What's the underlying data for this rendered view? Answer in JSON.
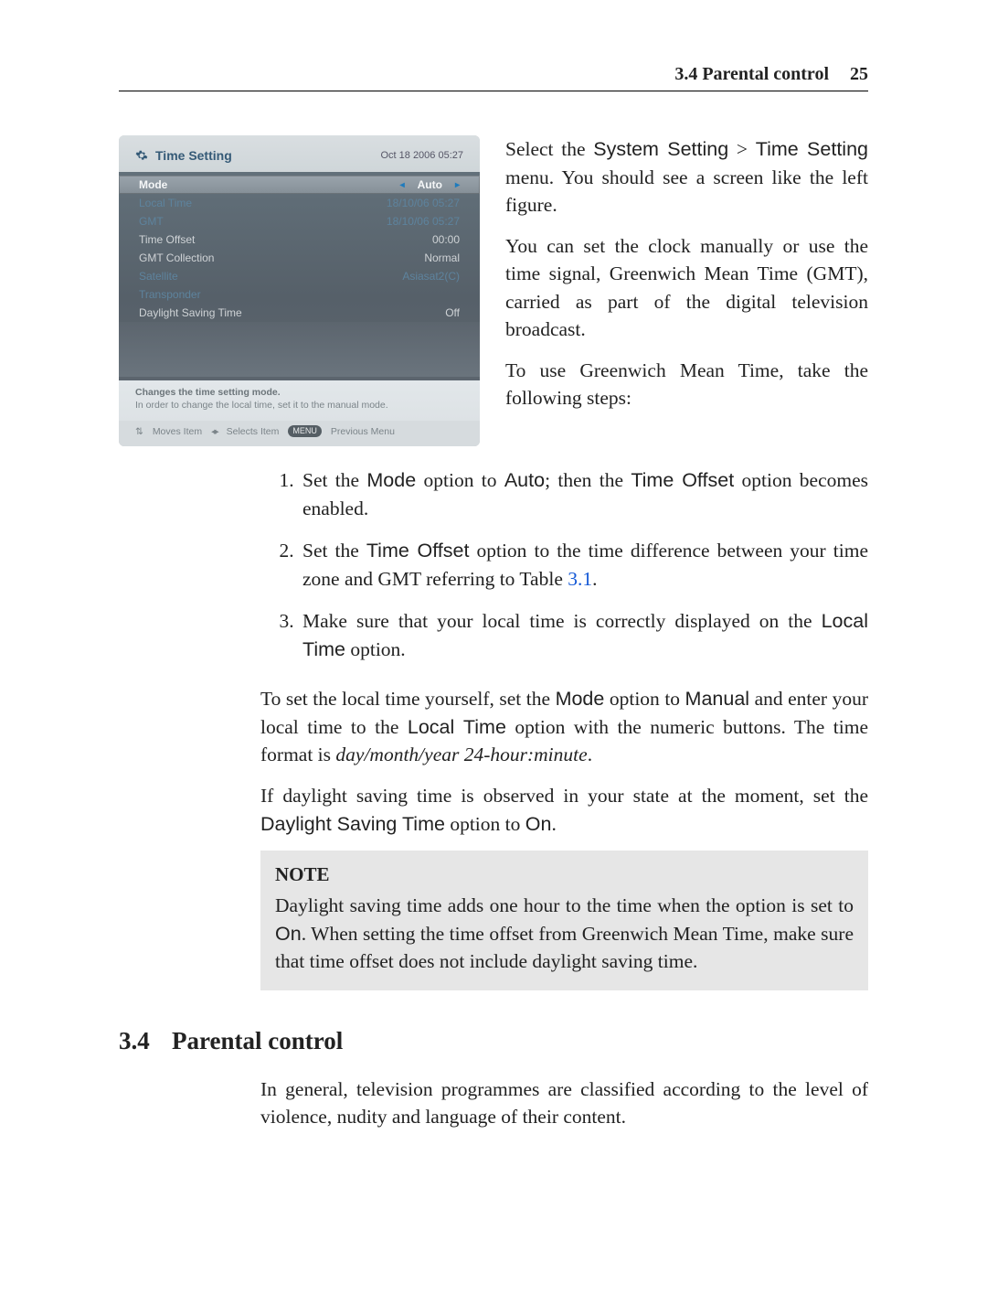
{
  "header": {
    "section": "3.4 Parental control",
    "page": "25"
  },
  "screenshot": {
    "title": "Time Setting",
    "timestamp": "Oct 18 2006 05:27",
    "rows": [
      {
        "label": "Mode",
        "value": "Auto",
        "state": "selected",
        "arrows": true
      },
      {
        "label": "Local Time",
        "value": "18/10/06 05:27",
        "state": "dim"
      },
      {
        "label": "GMT",
        "value": "18/10/06 05:27",
        "state": "dim"
      },
      {
        "label": "Time Offset",
        "value": "00:00",
        "state": "normal"
      },
      {
        "label": "GMT Collection",
        "value": "Normal",
        "state": "normal"
      },
      {
        "label": "Satellite",
        "value": "Asiasat2(C)",
        "state": "dim"
      },
      {
        "label": "Transponder",
        "value": "",
        "state": "dim"
      },
      {
        "label": "Daylight Saving Time",
        "value": "Off",
        "state": "normal"
      }
    ],
    "help1": "Changes the time setting mode.",
    "help2": "In order to change the local time, set it to the manual mode.",
    "foot_moves": "Moves Item",
    "foot_selects": "Selects Item",
    "foot_prev_key": "MENU",
    "foot_prev": "Previous Menu"
  },
  "intro": {
    "p1a": "Select the ",
    "p1_sys": "System Setting",
    "p1_gt": " > ",
    "p1_time": "Time Setting",
    "p1b": " menu. You should see a screen like the left figure.",
    "p2": "You can set the clock manually or use the time signal, Greenwich Mean Time (GMT), carried as part of the digital television broadcast.",
    "p3": "To use Greenwich Mean Time, take the following steps:"
  },
  "steps": {
    "s1a": "Set the ",
    "s1_mode": "Mode",
    "s1b": " option to ",
    "s1_auto": "Auto",
    "s1c": "; then the ",
    "s1_to": "Time Offset",
    "s1d": " option becomes enabled.",
    "s2a": "Set the ",
    "s2_to": "Time Offset",
    "s2b": " option to the time difference between your time zone and GMT referring to Table ",
    "s2_link": "3.1",
    "s2c": ".",
    "s3a": "Make sure that your local time is correctly displayed on the ",
    "s3_lt": "Local Time",
    "s3b": " option."
  },
  "para": {
    "p4a": "To set the local time yourself, set the ",
    "p4_mode": "Mode",
    "p4b": " option to ",
    "p4_manual": "Manual",
    "p4c": " and enter your local time to the ",
    "p4_lt": "Local Time",
    "p4d": " option with the numeric buttons. The time format is ",
    "p4_fmt": "day/month/year 24-hour:minute",
    "p4e": ".",
    "p5a": "If daylight saving time is observed in your state at the moment, set the ",
    "p5_dst": "Daylight Saving Time",
    "p5b": " option to ",
    "p5_on": "On",
    "p5c": "."
  },
  "note": {
    "title": "NOTE",
    "a": "Daylight saving time adds one hour to the time when the option is set to ",
    "on": "On",
    "b": ". When setting the time offset from Greenwich Mean Time, make sure that time offset does not include daylight saving time."
  },
  "section34": {
    "num": "3.4",
    "title": "Parental control",
    "p": "In general, television programmes are classified according to the level of violence, nudity and language of their content."
  }
}
